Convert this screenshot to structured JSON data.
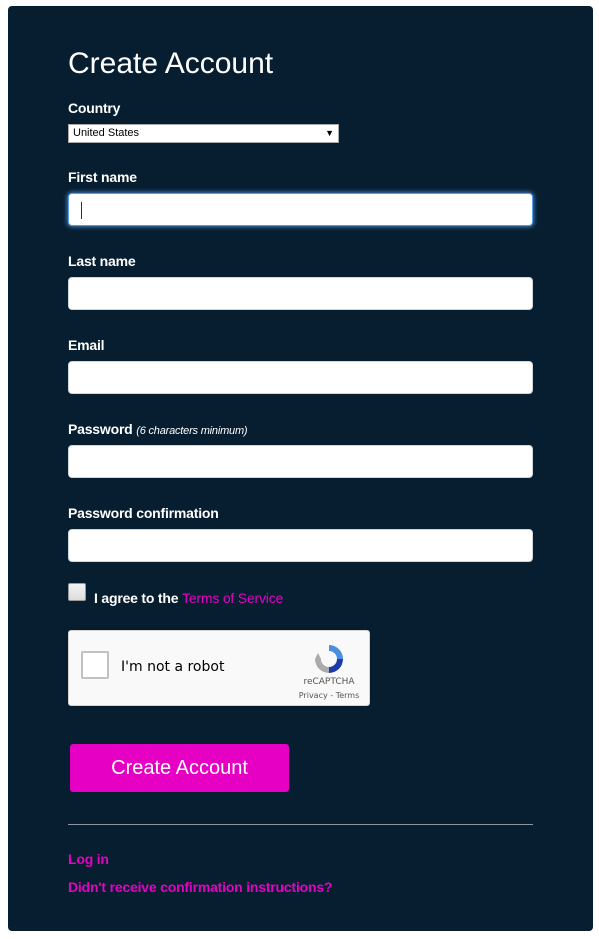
{
  "title": "Create Account",
  "country": {
    "label": "Country",
    "selected": "United States"
  },
  "first_name": {
    "label": "First name",
    "value": ""
  },
  "last_name": {
    "label": "Last name",
    "value": ""
  },
  "email": {
    "label": "Email",
    "value": ""
  },
  "password": {
    "label": "Password",
    "hint": "(6 characters minimum)",
    "value": ""
  },
  "password_confirmation": {
    "label": "Password confirmation",
    "value": ""
  },
  "terms": {
    "prefix": "I agree to the",
    "link": "Terms of Service",
    "checked": false
  },
  "recaptcha": {
    "text": "I'm not a robot",
    "brand": "reCAPTCHA",
    "links": "Privacy - Terms"
  },
  "submit_label": "Create Account",
  "footer": {
    "login": "Log in",
    "resend": "Didn't receive confirmation instructions?"
  },
  "colors": {
    "background": "#071e30",
    "accent": "#e600c4"
  }
}
